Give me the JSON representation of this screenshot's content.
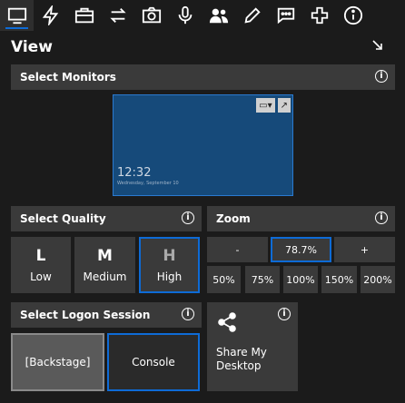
{
  "toolbar": {
    "icons": [
      "monitor-icon",
      "lightning-icon",
      "toolbox-icon",
      "transfer-arrows-icon",
      "camera-icon",
      "microphone-icon",
      "users-icon",
      "pencil-icon",
      "chat-icon",
      "plus-cross-icon",
      "info-circle-icon"
    ]
  },
  "panel": {
    "title": "View"
  },
  "select_monitors": {
    "header": "Select Monitors",
    "preview": {
      "time": "12:32",
      "date": "Wednesday, September 10"
    }
  },
  "select_quality": {
    "header": "Select Quality",
    "options": [
      {
        "letter": "L",
        "label": "Low"
      },
      {
        "letter": "M",
        "label": "Medium"
      },
      {
        "letter": "H",
        "label": "High",
        "selected": true
      }
    ]
  },
  "zoom": {
    "header": "Zoom",
    "minus": "-",
    "value": "78.7%",
    "plus": "+",
    "presets": [
      "50%",
      "75%",
      "100%",
      "150%",
      "200%"
    ]
  },
  "logon_session": {
    "header": "Select Logon Session",
    "options": [
      "[Backstage]",
      "Console"
    ]
  },
  "share": {
    "label": "Share My Desktop"
  },
  "colors": {
    "accent": "#0e6bd6",
    "tile": "#3a3a3a",
    "background": "#1b1b1b",
    "monitor": "#164a7a"
  }
}
